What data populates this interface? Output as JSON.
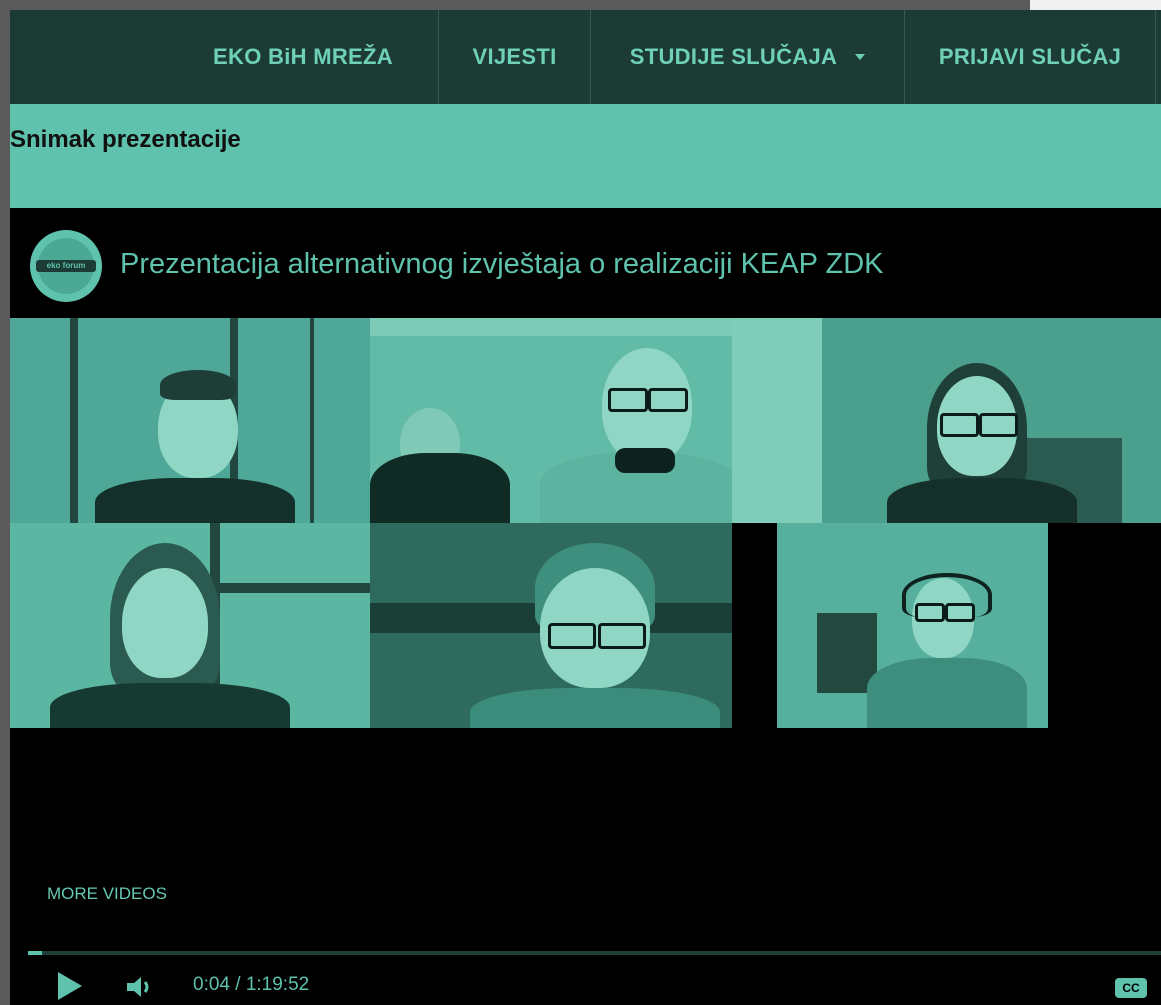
{
  "nav": {
    "items": [
      {
        "label": "EKO BiH MREŽA"
      },
      {
        "label": "VIJESTI"
      },
      {
        "label": "STUDIJE SLUČAJA"
      },
      {
        "label": "PRIJAVI SLUČAJ"
      }
    ]
  },
  "section": {
    "title": "Snimak prezentacije"
  },
  "player": {
    "channel_logo_text": "eko forum",
    "title": "Prezentacija alternativnog izvještaja o realizaciji KEAP ZDK",
    "more_videos": "MORE VIDEOS",
    "time": "0:04 / 1:19:52",
    "progress": 0.0008,
    "cc_label": "CC"
  },
  "colors": {
    "accent": "#5ec2ad",
    "nav_bg": "#1d3b35",
    "player_bg": "#000000"
  }
}
